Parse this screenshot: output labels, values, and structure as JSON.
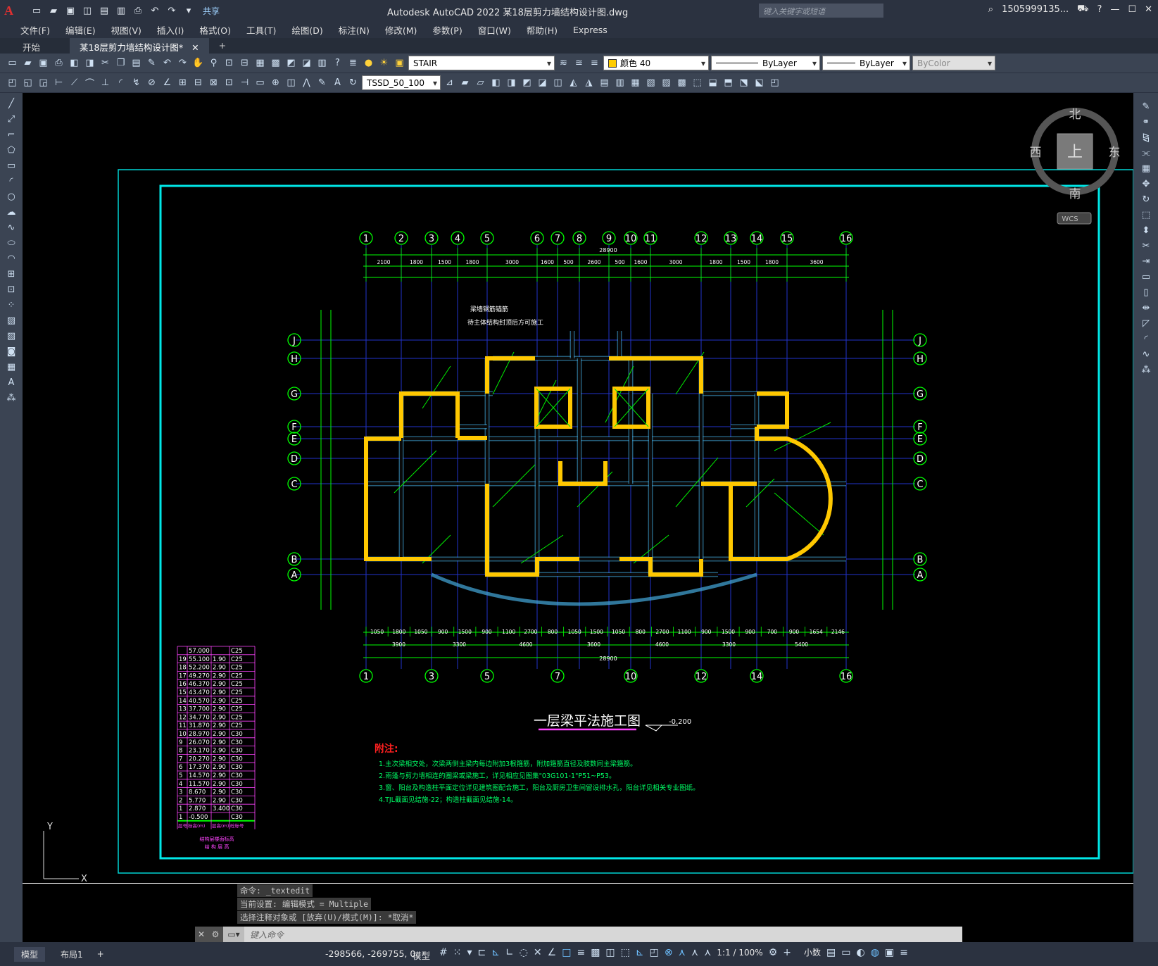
{
  "app": {
    "logo": "A",
    "window_title": "Autodesk AutoCAD 2022    某18层剪力墙结构设计图.dwg",
    "share_label": "共享",
    "search_placeholder": "键入关键字或短语",
    "user": "1505999135...",
    "menu": [
      "文件(F)",
      "编辑(E)",
      "视图(V)",
      "插入(I)",
      "格式(O)",
      "工具(T)",
      "绘图(D)",
      "标注(N)",
      "修改(M)",
      "参数(P)",
      "窗口(W)",
      "帮助(H)",
      "Express"
    ],
    "doc_tabs": [
      {
        "label": "开始"
      },
      {
        "label": "某18层剪力墙结构设计图*"
      }
    ]
  },
  "toolbar": {
    "layer": "STAIR",
    "color": "颜色 40",
    "linetype": "ByLayer",
    "lineweight": "ByLayer",
    "plotstyle": "ByColor",
    "dimstyle": "TSSD_50_100"
  },
  "viewcube": {
    "north": "北",
    "south": "南",
    "east": "东",
    "west": "西",
    "top": "上",
    "wcs": "WCS"
  },
  "drawing": {
    "top_axes": [
      "1",
      "2",
      "3",
      "4",
      "5",
      "6",
      "7",
      "8",
      "9",
      "10",
      "11",
      "12",
      "13",
      "14",
      "15",
      "16"
    ],
    "bottom_axes": [
      "1",
      "3",
      "5",
      "7",
      "10",
      "12",
      "14",
      "16"
    ],
    "row_axes": [
      "J",
      "H",
      "G",
      "F",
      "E",
      "D",
      "C",
      "B",
      "A"
    ],
    "top_dims": [
      "2100",
      "1800",
      "1500",
      "1800",
      "3000",
      "1600",
      "500",
      "2600",
      "500",
      "1600",
      "3000",
      "1800",
      "1500",
      "1800",
      "3600"
    ],
    "top_total": "28900",
    "bottom_dims": [
      "1050",
      "1800",
      "1050",
      "900",
      "1500",
      "900",
      "1100",
      "2700",
      "800",
      "1050",
      "1500",
      "1050",
      "800",
      "2700",
      "1100",
      "900",
      "1500",
      "900",
      "700",
      "900",
      "1654",
      "2146"
    ],
    "bottom_dims2": [
      "3900",
      "3300",
      "4600",
      "3600",
      "4600",
      "3300",
      "5400"
    ],
    "bottom_total": "28900",
    "title": "一层梁平法施工图",
    "elevation": "-0.200",
    "notes_title": "附注:",
    "notes": [
      "1.主次梁相交处，次梁两侧主梁内每边附加3根箍筋，附加箍筋直径及肢数同主梁箍筋。",
      "2.雨篷与剪力墙相连的圈梁或梁施工，详见相应见图集\"03G101-1\"P51~P53。",
      "3.窗、阳台及构造柱平面定位详见建筑图配合施工，阳台及厨房卫生间留设排水孔，阳台详见相关专业图纸。",
      "4.TJL截面见结施-22；构造柱截面见结施-14。"
    ],
    "top_note_1": "梁墙钢筋锚筋",
    "top_note_2": "待主体结构封顶后方可施工",
    "floor_table": {
      "rows": [
        [
          "",
          "57.000",
          "",
          "C25"
        ],
        [
          "19",
          "55.100",
          "1.90",
          "C25"
        ],
        [
          "18",
          "52.200",
          "2.90",
          "C25"
        ],
        [
          "17",
          "49.270",
          "2.90",
          "C25"
        ],
        [
          "16",
          "46.370",
          "2.90",
          "C25"
        ],
        [
          "15",
          "43.470",
          "2.90",
          "C25"
        ],
        [
          "14",
          "40.570",
          "2.90",
          "C25"
        ],
        [
          "13",
          "37.700",
          "2.90",
          "C25"
        ],
        [
          "12",
          "34.770",
          "2.90",
          "C25"
        ],
        [
          "11",
          "31.870",
          "2.90",
          "C25"
        ],
        [
          "10",
          "28.970",
          "2.90",
          "C30"
        ],
        [
          "9",
          "26.070",
          "2.90",
          "C30"
        ],
        [
          "8",
          "23.170",
          "2.90",
          "C30"
        ],
        [
          "7",
          "20.270",
          "2.90",
          "C30"
        ],
        [
          "6",
          "17.370",
          "2.90",
          "C30"
        ],
        [
          "5",
          "14.570",
          "2.90",
          "C30"
        ],
        [
          "4",
          "11.570",
          "2.90",
          "C30"
        ],
        [
          "3",
          "8.670",
          "2.90",
          "C30"
        ],
        [
          "2",
          "5.770",
          "2.90",
          "C30"
        ],
        [
          "1",
          "2.870",
          "3.400",
          "C30"
        ],
        [
          "1",
          "-0.500",
          "",
          "C30"
        ]
      ],
      "header": [
        "层号",
        "标高(m)",
        "层高(m)",
        "砼标号"
      ],
      "caption1": "结构层楼面标高",
      "caption2": "结 构 层 高"
    }
  },
  "command": {
    "history": [
      "命令: _textedit",
      "当前设置: 编辑模式 = Multiple",
      "选择注释对象或 [放弃(U)/模式(M)]: *取消*"
    ],
    "placeholder": "键入命令"
  },
  "status": {
    "layout_tabs": [
      "模型",
      "布局1"
    ],
    "coords": "-298566, -269755, 0",
    "space": "模型",
    "scale": "1:1 / 100%",
    "units": "小数"
  }
}
